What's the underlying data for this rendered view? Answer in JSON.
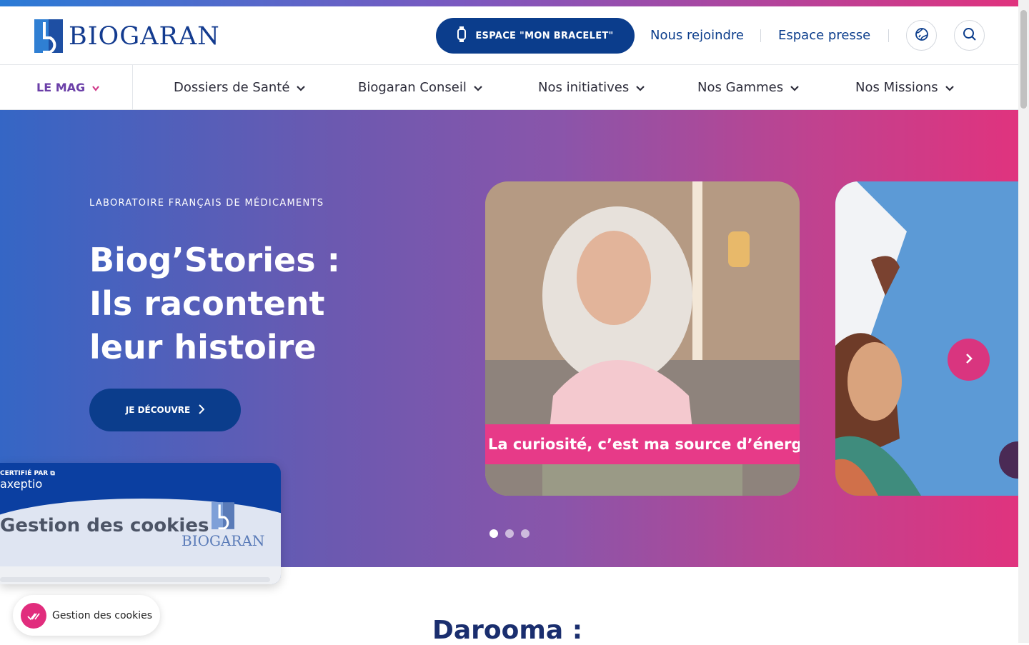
{
  "header": {
    "logo_text": "BIOGARAN",
    "bracelet_button": "ESPACE \"MON BRACELET\"",
    "links": [
      "Nous rejoindre",
      "Espace presse"
    ],
    "icons": [
      "watch-icon",
      "globe-icon",
      "search-icon"
    ]
  },
  "nav": {
    "mag_label": "LE MAG",
    "items": [
      "Dossiers de Santé",
      "Biogaran Conseil",
      "Nos initiatives",
      "Nos Gammes",
      "Nos Missions"
    ]
  },
  "hero": {
    "eyebrow": "LABORATOIRE FRANÇAIS DE MÉDICAMENTS",
    "title": "Biog’Stories : Ils racontent leur histoire",
    "cta_label": "JE DÉCOUVRE",
    "slide_caption": "La curiosité, c’est ma source d’énergie !",
    "dots": 3,
    "active_dot": 1
  },
  "cookie_panel": {
    "certified": "CERTIFIÉ PAR",
    "provider": "axeptio",
    "title": "Gestion des cookies",
    "brand": "BIOGARAN"
  },
  "cookie_pill": {
    "label": "Gestion des cookies"
  },
  "below": {
    "title": "Darooma :"
  },
  "colors": {
    "brand_blue": "#0b3d8c",
    "accent_pink": "#e0337e",
    "purple": "#6b3fa8"
  }
}
